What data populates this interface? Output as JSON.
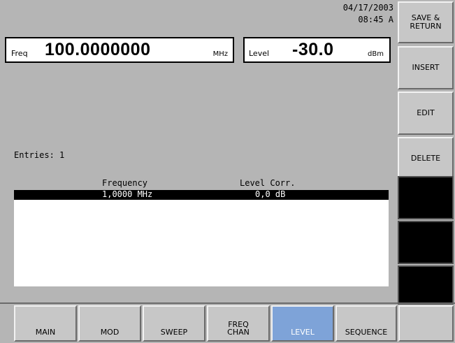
{
  "datetime": {
    "date": "04/17/2003",
    "time": "08:45 A"
  },
  "freq": {
    "label": "Freq",
    "value": "100.0000000",
    "unit": "MHz"
  },
  "level": {
    "label": "Level",
    "value": "-30.0",
    "unit": "dBm"
  },
  "entries": {
    "label": "Entries:",
    "count": "1"
  },
  "table": {
    "headers": [
      "Frequency",
      "Level Corr."
    ],
    "rows": [
      {
        "frequency": "1,0000 MHz",
        "corr": "0,0 dB",
        "selected": true
      }
    ]
  },
  "softkeys": [
    "SAVE &\nRETURN",
    "INSERT",
    "EDIT",
    "DELETE",
    "",
    "",
    ""
  ],
  "tabs": [
    "MAIN",
    "MOD",
    "SWEEP",
    "FREQ\nCHAN",
    "LEVEL",
    "SEQUENCE",
    ""
  ],
  "active_tab": "LEVEL",
  "colors": {
    "background": "#b5b5b5",
    "active_tab": "#7ea3d8",
    "selection": "#000000"
  }
}
